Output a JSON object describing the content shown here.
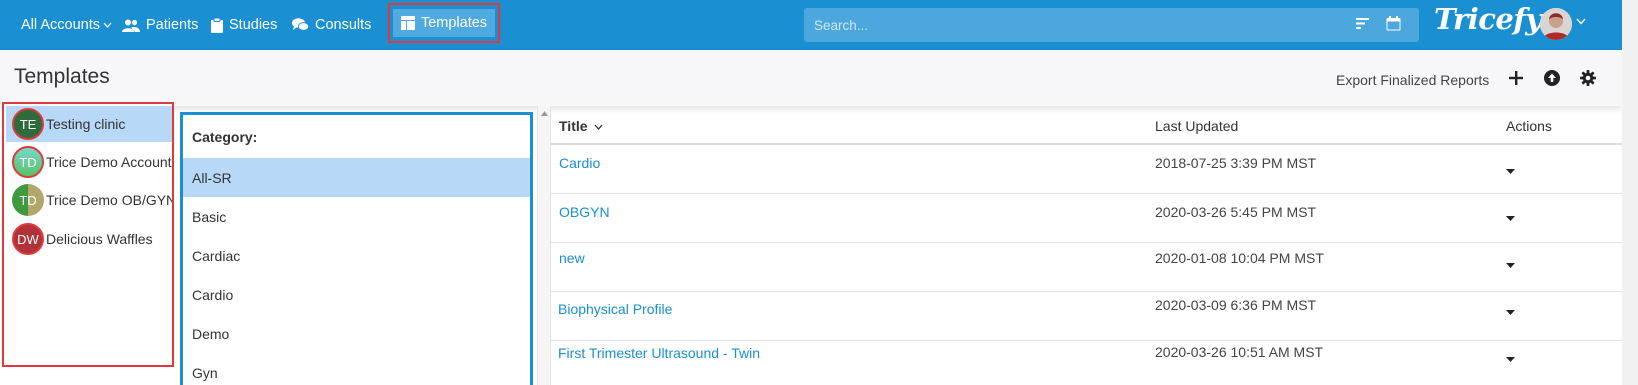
{
  "nav": {
    "all_accounts": "All Accounts",
    "patients": "Patients",
    "studies": "Studies",
    "consults": "Consults",
    "templates": "Templates"
  },
  "search": {
    "placeholder": "Search..."
  },
  "brand": {
    "logo": "Tricefy"
  },
  "header": {
    "title": "Templates",
    "export_label": "Export Finalized Reports"
  },
  "accounts": [
    {
      "initials": "TE",
      "name": "Testing clinic",
      "color": "#2e6b3a",
      "selected": true
    },
    {
      "initials": "TD",
      "name": "Trice Demo Account",
      "color": "#5ec47d"
    },
    {
      "initials": "TD",
      "name": "Trice Demo OB/GYN",
      "color": "#6b9e3a"
    },
    {
      "initials": "DW",
      "name": "Delicious Waffles",
      "color": "#b0323a"
    }
  ],
  "category": {
    "label": "Category:",
    "items": [
      "All-SR",
      "Basic",
      "Cardiac",
      "Cardio",
      "Demo",
      "Gyn"
    ],
    "selected": "All-SR"
  },
  "table": {
    "columns": {
      "title": "Title",
      "updated": "Last Updated",
      "actions": "Actions"
    },
    "rows": [
      {
        "title": "Cardio",
        "updated": "2018-07-25 3:39 PM MST"
      },
      {
        "title": "OBGYN",
        "updated": "2020-03-26 5:45 PM MST"
      },
      {
        "title": " new",
        "updated": "2020-01-08 10:04 PM MST"
      },
      {
        "title": " Biophysical Profile",
        "updated": "2020-03-09 6:36 PM MST"
      },
      {
        "title": " First Trimester Ultrasound - Twin",
        "updated": "2020-03-26 10:51 AM MST"
      }
    ]
  },
  "colors": {
    "primary": "#1a8fd1",
    "highlight": "#e0393e",
    "selected_bg": "#b7d9f7"
  }
}
